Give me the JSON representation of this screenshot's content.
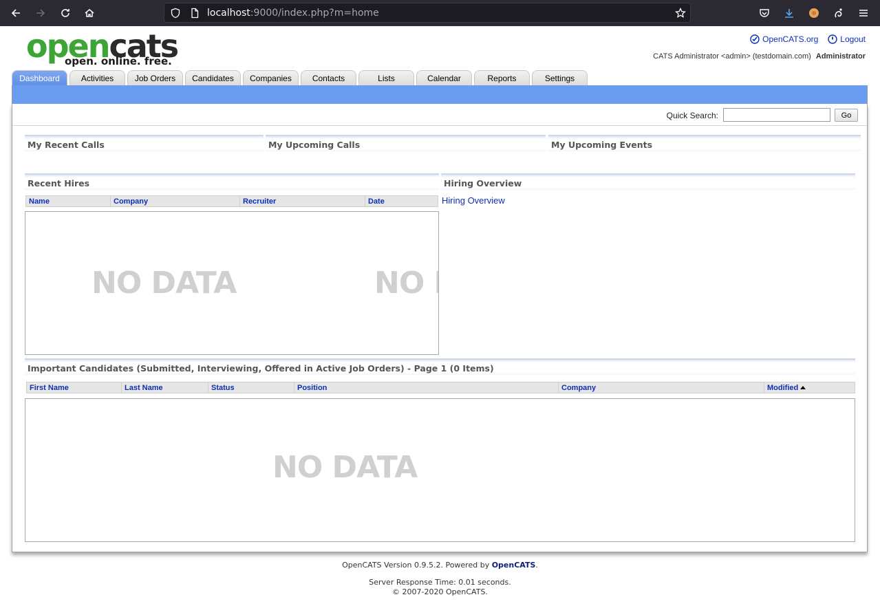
{
  "browser": {
    "url_host": "localhost",
    "url_rest": ":9000/index.php?m=home"
  },
  "logo": {
    "open": "open",
    "cats": "cats",
    "tagline": "open. online. free."
  },
  "header": {
    "opencats_link": "OpenCATS.org",
    "logout_link": "Logout",
    "user_line": "CATS Administrator <admin> (testdomain.com)",
    "role": "Administrator"
  },
  "tabs": [
    {
      "label": "Dashboard",
      "active": true
    },
    {
      "label": "Activities"
    },
    {
      "label": "Job Orders"
    },
    {
      "label": "Candidates"
    },
    {
      "label": "Companies"
    },
    {
      "label": "Contacts"
    },
    {
      "label": "Lists"
    },
    {
      "label": "Calendar"
    },
    {
      "label": "Reports"
    },
    {
      "label": "Settings"
    }
  ],
  "quick_search": {
    "label": "Quick Search:",
    "value": "",
    "button": "Go"
  },
  "sections": {
    "recent_calls": "My Recent Calls",
    "upcoming_calls": "My Upcoming Calls",
    "upcoming_events": "My Upcoming Events",
    "recent_hires": "Recent Hires",
    "hiring_overview": "Hiring Overview",
    "important_candidates": "Important Candidates (Submitted, Interviewing, Offered in Active Job Orders) - Page 1 (0 Items)"
  },
  "recent_hires_columns": [
    "Name",
    "Company",
    "Recruiter",
    "Date"
  ],
  "hiring_overview_link": "Hiring Overview",
  "candidates_columns": [
    "First Name",
    "Last Name",
    "Status",
    "Position",
    "Company",
    "Modified"
  ],
  "nodata_text": "NO DATA",
  "nodata_partial": "NO D",
  "footer": {
    "version_prefix": "OpenCATS Version 0.9.5.2. Powered by ",
    "version_link": "OpenCATS",
    "version_suffix": ".",
    "response_time": "Server Response Time: 0.01 seconds.",
    "copyright": "© 2007-2020 OpenCATS."
  }
}
